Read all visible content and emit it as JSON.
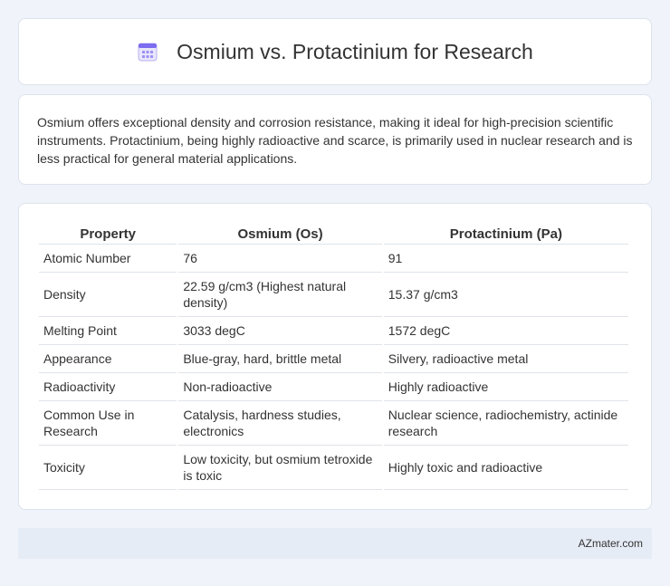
{
  "header": {
    "title": "Osmium vs. Protactinium for Research",
    "icon": "calendar-icon"
  },
  "intro": {
    "text": "Osmium offers exceptional density and corrosion resistance, making it ideal for high-precision scientific instruments. Protactinium, being highly radioactive and scarce, is primarily used in nuclear research and is less practical for general material applications."
  },
  "table": {
    "columns": [
      "Property",
      "Osmium (Os)",
      "Protactinium (Pa)"
    ],
    "rows": [
      [
        "Atomic Number",
        "76",
        "91"
      ],
      [
        "Density",
        "22.59 g/cm3 (Highest natural density)",
        "15.37 g/cm3"
      ],
      [
        "Melting Point",
        "3033 degC",
        "1572 degC"
      ],
      [
        "Appearance",
        "Blue-gray, hard, brittle metal",
        "Silvery, radioactive metal"
      ],
      [
        "Radioactivity",
        "Non-radioactive",
        "Highly radioactive"
      ],
      [
        "Common Use in Research",
        "Catalysis, hardness studies, electronics",
        "Nuclear science, radiochemistry, actinide research"
      ],
      [
        "Toxicity",
        "Low toxicity, but osmium tetroxide is toxic",
        "Highly toxic and radioactive"
      ]
    ]
  },
  "footer": {
    "brand": "AZmater.com"
  },
  "colors": {
    "page_bg": "#f0f3f9",
    "footer_bg": "#e6ecf6",
    "icon_accent": "#7b6cf0"
  }
}
